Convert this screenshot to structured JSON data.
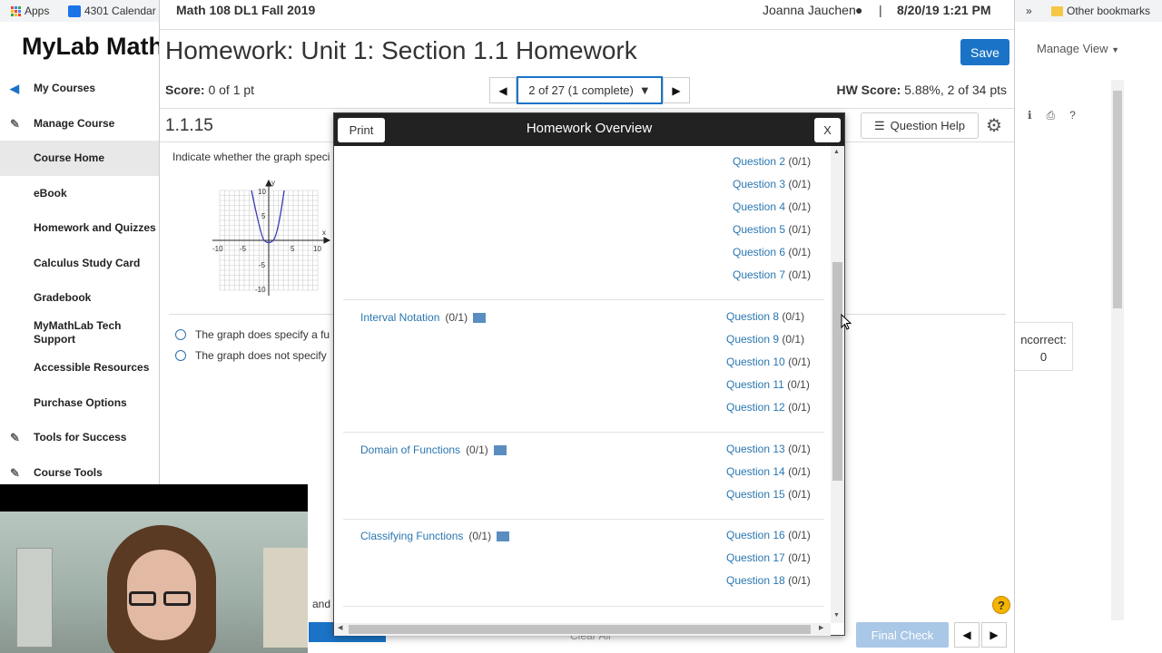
{
  "bookmarks": {
    "apps": "Apps",
    "calendar": "4301 Calendar",
    "more": "»",
    "other": "Other bookmarks"
  },
  "brand": "MyLab Math",
  "sidebar": {
    "items": [
      {
        "label": "My Courses",
        "icon": "arrow-left-circle-icon"
      },
      {
        "label": "Manage Course",
        "icon": "wrench-icon"
      },
      {
        "label": "Course Home"
      },
      {
        "label": "eBook"
      },
      {
        "label": "Homework and Quizzes"
      },
      {
        "label": "Calculus Study Card"
      },
      {
        "label": "Gradebook"
      },
      {
        "label": "MyMathLab Tech Support"
      },
      {
        "label": "Accessible Resources"
      },
      {
        "label": "Purchase Options"
      },
      {
        "label": "Tools for Success",
        "icon": "tools-icon"
      },
      {
        "label": "Course Tools",
        "icon": "wrench-icon"
      }
    ]
  },
  "topbar": {
    "course": "Math 108 DL1 Fall 2019",
    "user": "Joanna Jauchen",
    "sep": "|",
    "datetime": "8/20/19 1:21 PM"
  },
  "header": {
    "title": "Homework: Unit 1: Section 1.1 Homework",
    "save": "Save"
  },
  "score": {
    "label": "Score:",
    "value": "0 of 1 pt"
  },
  "hwscore": {
    "label": "HW Score:",
    "value": "5.88%, 2 of 34 pts"
  },
  "pager": {
    "current": "2 of 27 (1 complete)"
  },
  "question": {
    "number": "1.1.15",
    "help": "Question Help",
    "prompt": "Indicate whether the graph speci",
    "options": [
      "The graph does specify a fu",
      "The graph does not specify"
    ]
  },
  "graph": {
    "ticks_x": [
      "-10",
      "-5",
      "5",
      "10"
    ],
    "ticks_y": [
      "10",
      "5",
      "-5",
      "-10"
    ],
    "xlabel": "x",
    "ylabel": "y"
  },
  "right": {
    "manage_view": "Manage View",
    "incorrect_label": "ncorrect:",
    "incorrect_value": "0"
  },
  "bottom": {
    "final_check": "Final Check",
    "clear_all": "Clear All",
    "and": "and"
  },
  "modal": {
    "title": "Homework Overview",
    "print": "Print",
    "close": "X",
    "top_questions": [
      {
        "q": "Question 2",
        "s": "(0/1)"
      },
      {
        "q": "Question 3",
        "s": "(0/1)"
      },
      {
        "q": "Question 4",
        "s": "(0/1)"
      },
      {
        "q": "Question 5",
        "s": "(0/1)"
      },
      {
        "q": "Question 6",
        "s": "(0/1)"
      },
      {
        "q": "Question 7",
        "s": "(0/1)"
      }
    ],
    "sections": [
      {
        "name": "Interval Notation",
        "score": "(0/1)",
        "questions": [
          {
            "q": "Question 8",
            "s": "(0/1)"
          },
          {
            "q": "Question 9",
            "s": "(0/1)"
          },
          {
            "q": "Question 10",
            "s": "(0/1)"
          },
          {
            "q": "Question 11",
            "s": "(0/1)"
          },
          {
            "q": "Question 12",
            "s": "(0/1)"
          }
        ]
      },
      {
        "name": "Domain of Functions",
        "score": "(0/1)",
        "questions": [
          {
            "q": "Question 13",
            "s": "(0/1)"
          },
          {
            "q": "Question 14",
            "s": "(0/1)"
          },
          {
            "q": "Question 15",
            "s": "(0/1)"
          }
        ]
      },
      {
        "name": "Classifying Functions",
        "score": "(0/1)",
        "questions": [
          {
            "q": "Question 16",
            "s": "(0/1)"
          },
          {
            "q": "Question 17",
            "s": "(0/1)"
          },
          {
            "q": "Question 18",
            "s": "(0/1)"
          }
        ]
      }
    ]
  }
}
